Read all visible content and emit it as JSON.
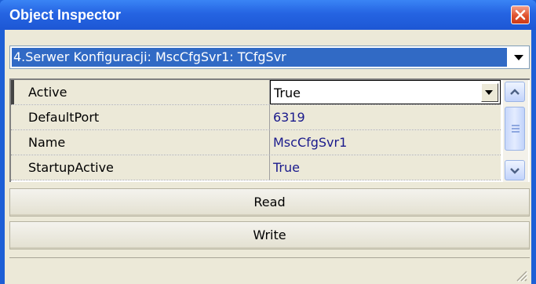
{
  "window": {
    "title": "Object Inspector"
  },
  "object_selector": {
    "selected": "4.Serwer Konfiguracji: MscCfgSvr1: TCfgSvr"
  },
  "properties": [
    {
      "name": "Active",
      "value": "True"
    },
    {
      "name": "DefaultPort",
      "value": "6319"
    },
    {
      "name": "Name",
      "value": "MscCfgSvr1"
    },
    {
      "name": "StartupActive",
      "value": "True"
    }
  ],
  "buttons": {
    "read": "Read",
    "write": "Write"
  },
  "colors": {
    "titlebar": "#2564e2",
    "selection": "#316ac5",
    "value_text": "#1a1a8c",
    "face": "#ece9d8"
  }
}
